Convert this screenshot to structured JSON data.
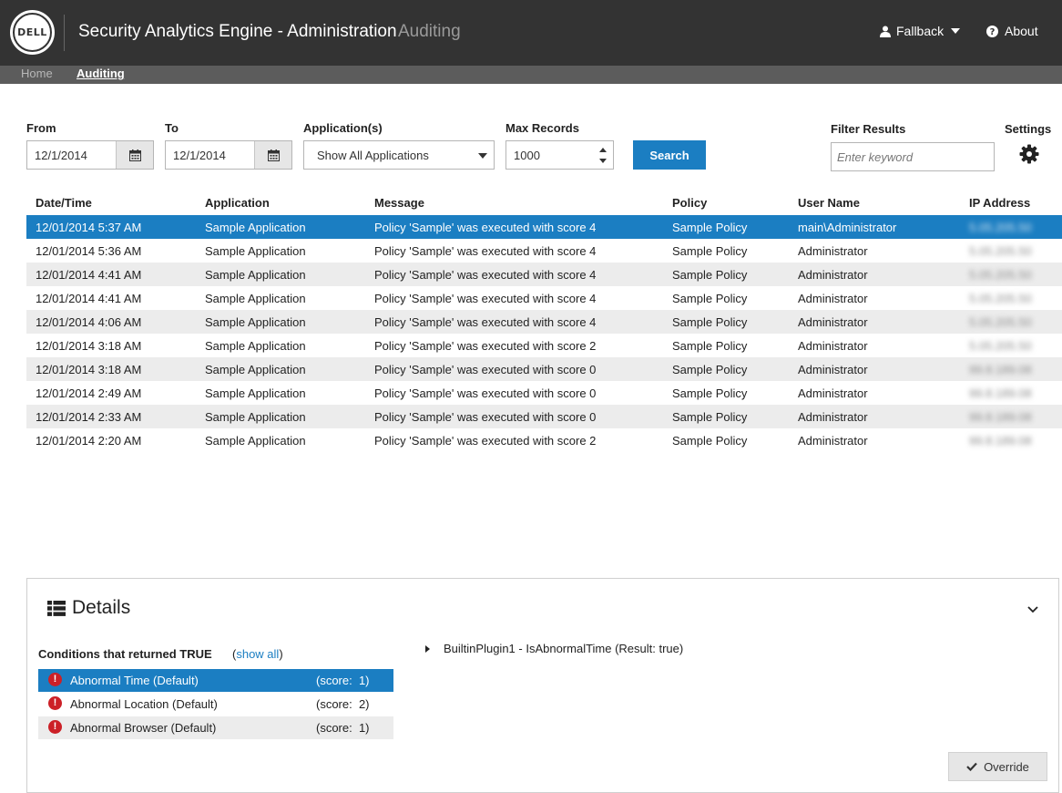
{
  "header": {
    "logo_text": "DELL",
    "title": "Security Analytics Engine - Administration",
    "subtitle": "Auditing",
    "user_menu": "Fallback",
    "about": "About"
  },
  "nav": {
    "items": [
      {
        "label": "Home",
        "active": false
      },
      {
        "label": "Auditing",
        "active": true
      }
    ]
  },
  "filters": {
    "from_label": "From",
    "from_value": "12/1/2014",
    "to_label": "To",
    "to_value": "12/1/2014",
    "application_label": "Application(s)",
    "application_value": "Show All Applications",
    "max_records_label": "Max Records",
    "max_records_value": "1000",
    "search_label": "Search",
    "filter_label": "Filter Results",
    "filter_placeholder": "Enter keyword",
    "settings_label": "Settings"
  },
  "table": {
    "columns": [
      "Date/Time",
      "Application",
      "Message",
      "Policy",
      "User Name",
      "IP Address"
    ],
    "rows": [
      {
        "datetime": "12/01/2014 5:37 AM",
        "application": "Sample Application",
        "message": "Policy 'Sample' was executed with score 4",
        "policy": "Sample Policy",
        "user": "main\\Administrator",
        "ip": "5.05.205.50",
        "selected": true
      },
      {
        "datetime": "12/01/2014 5:36 AM",
        "application": "Sample Application",
        "message": "Policy 'Sample' was executed with score 4",
        "policy": "Sample Policy",
        "user": "Administrator",
        "ip": "5.05.205.50"
      },
      {
        "datetime": "12/01/2014 4:41 AM",
        "application": "Sample Application",
        "message": "Policy 'Sample' was executed with score 4",
        "policy": "Sample Policy",
        "user": "Administrator",
        "ip": "5.05.205.50"
      },
      {
        "datetime": "12/01/2014 4:41 AM",
        "application": "Sample Application",
        "message": "Policy 'Sample' was executed with score 4",
        "policy": "Sample Policy",
        "user": "Administrator",
        "ip": "5.05.205.50"
      },
      {
        "datetime": "12/01/2014 4:06 AM",
        "application": "Sample Application",
        "message": "Policy 'Sample' was executed with score 4",
        "policy": "Sample Policy",
        "user": "Administrator",
        "ip": "5.05.205.50"
      },
      {
        "datetime": "12/01/2014 3:18 AM",
        "application": "Sample Application",
        "message": "Policy 'Sample' was executed with score 2",
        "policy": "Sample Policy",
        "user": "Administrator",
        "ip": "5.05.205.50"
      },
      {
        "datetime": "12/01/2014 3:18 AM",
        "application": "Sample Application",
        "message": "Policy 'Sample' was executed with score 0",
        "policy": "Sample Policy",
        "user": "Administrator",
        "ip": "99.8.189.08"
      },
      {
        "datetime": "12/01/2014 2:49 AM",
        "application": "Sample Application",
        "message": "Policy 'Sample' was executed with score 0",
        "policy": "Sample Policy",
        "user": "Administrator",
        "ip": "99.8.189.08"
      },
      {
        "datetime": "12/01/2014 2:33 AM",
        "application": "Sample Application",
        "message": "Policy 'Sample' was executed with score 0",
        "policy": "Sample Policy",
        "user": "Administrator",
        "ip": "99.8.189.08"
      },
      {
        "datetime": "12/01/2014 2:20 AM",
        "application": "Sample Application",
        "message": "Policy 'Sample' was executed with score 2",
        "policy": "Sample Policy",
        "user": "Administrator",
        "ip": "99.8.189.08"
      }
    ]
  },
  "details": {
    "title": "Details",
    "conditions_title": "Conditions that returned TRUE",
    "show_all": "show all",
    "conditions": [
      {
        "name": "Abnormal Time (Default)",
        "score": "(score:  1)",
        "selected": true
      },
      {
        "name": "Abnormal Location (Default)",
        "score": "(score:  2)"
      },
      {
        "name": "Abnormal Browser (Default)",
        "score": "(score:  1)"
      }
    ],
    "tree_node": "BuiltinPlugin1 - IsAbnormalTime (Result: true)",
    "override_label": "Override"
  },
  "colors": {
    "accent": "#1b7ec2",
    "header_bg": "#333333",
    "nav_bg": "#5c5c5c",
    "alert": "#cc2027"
  }
}
